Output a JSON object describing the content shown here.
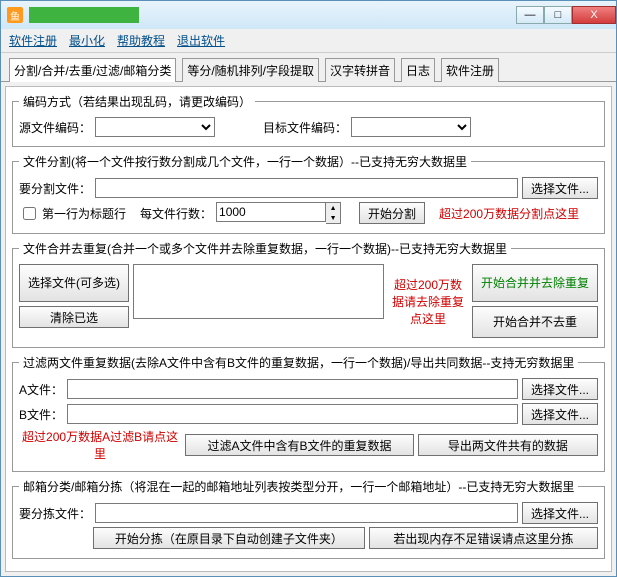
{
  "titlebar": {
    "min": "—",
    "max": "□",
    "close": "X"
  },
  "menu": {
    "register": "软件注册",
    "minimize": "最小化",
    "help": "帮助教程",
    "exit": "退出软件"
  },
  "tabs": {
    "t1": "分割/合并/去重/过滤/邮箱分类",
    "t2": "等分/随机排列/字段提取",
    "t3": "汉字转拼音",
    "t4": "日志",
    "t5": "软件注册"
  },
  "enc": {
    "legend": "编码方式（若结果出现乱码，请更改编码）",
    "src": "源文件编码：",
    "dst": "目标文件编码："
  },
  "split": {
    "legend": "文件分割(将一个文件按行数分割成几个文件，一行一个数据）--已支持无穷大数据里",
    "file_label": "要分割文件：",
    "choose": "选择文件...",
    "header_row": "第一行为标题行",
    "per_file": "每文件行数：",
    "per_file_val": "1000",
    "start": "开始分割",
    "warn": "超过200万数据分割点这里"
  },
  "merge": {
    "legend": "文件合并去重复(合并一个或多个文件并去除重复数据，一行一个数据)--已支持无穷大数据里",
    "choose": "选择文件(可多选)",
    "clear": "清除已选",
    "warn": "超过200万数据请去除重复点这里",
    "start_dedup": "开始合并并去除重复",
    "start_nodedup": "开始合并不去重"
  },
  "filter": {
    "legend": "过滤两文件重复数据(去除A文件中含有B文件的重复数据，一行一个数据)/导出共同数据--支持无穷数据里",
    "a": "A文件：",
    "b": "B文件：",
    "choose": "选择文件...",
    "warn": "超过200万数据A过滤B请点这里",
    "filter_btn": "过滤A文件中含有B文件的重复数据",
    "export_btn": "导出两文件共有的数据"
  },
  "mail": {
    "legend": "邮箱分类/邮箱分拣（将混在一起的邮箱地址列表按类型分开，一行一个邮箱地址）--已支持无穷大数据里",
    "file_label": "要分拣文件：",
    "choose": "选择文件...",
    "start": "开始分拣（在原目录下自动创建子文件夹）",
    "oom": "若出现内存不足错误请点这里分拣"
  }
}
